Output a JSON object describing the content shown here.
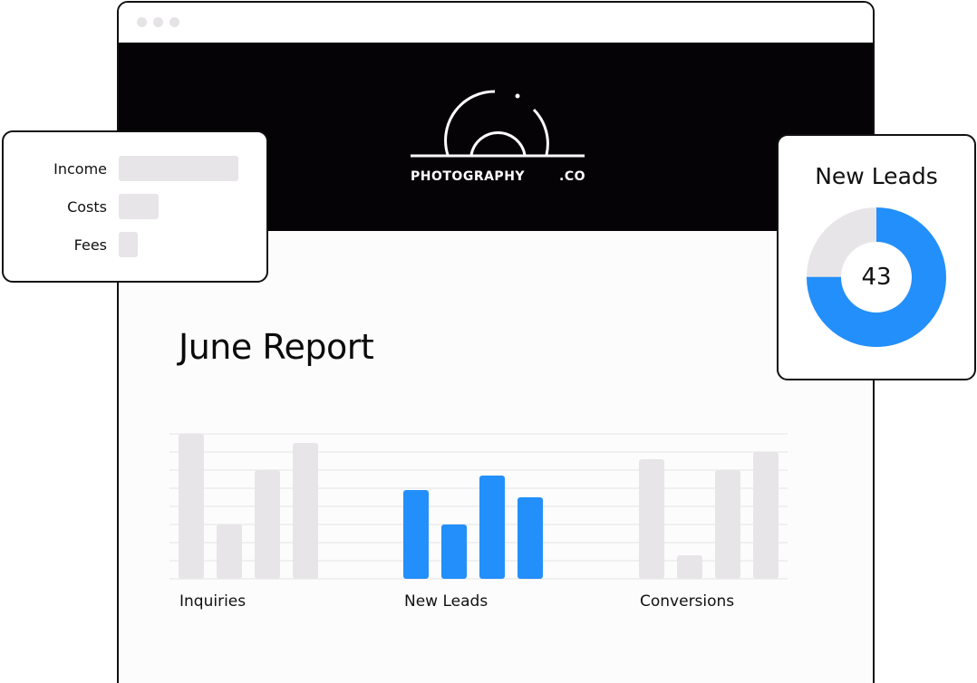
{
  "brand": {
    "name": "PHOTOGRAPHY",
    "suffix": ".CO"
  },
  "report": {
    "title": "June Report"
  },
  "finance_card": {
    "items": [
      {
        "label": "Income",
        "level": 1.0
      },
      {
        "label": "Costs",
        "level": 0.33
      },
      {
        "label": "Fees",
        "level": 0.16
      }
    ]
  },
  "leads_card": {
    "title": "New Leads",
    "value": "43",
    "fill_fraction": 0.75,
    "accent_color": "#238ffa",
    "track_color": "#e8e5e8"
  },
  "chart_data": {
    "type": "bar",
    "categories": [
      "Inquiries",
      "New Leads",
      "Conversions"
    ],
    "series_per_group": 4,
    "groups": [
      {
        "name": "Inquiries",
        "values": [
          8,
          3,
          6,
          7.5
        ],
        "color": "#e8e5e8"
      },
      {
        "name": "New Leads",
        "values": [
          4.9,
          3,
          5.7,
          4.5
        ],
        "color": "#238ffa"
      },
      {
        "name": "Conversions",
        "values": [
          6.6,
          1.3,
          6,
          7
        ],
        "color": "#e8e5e8"
      }
    ],
    "ylim": [
      0,
      8
    ],
    "grid": true
  }
}
